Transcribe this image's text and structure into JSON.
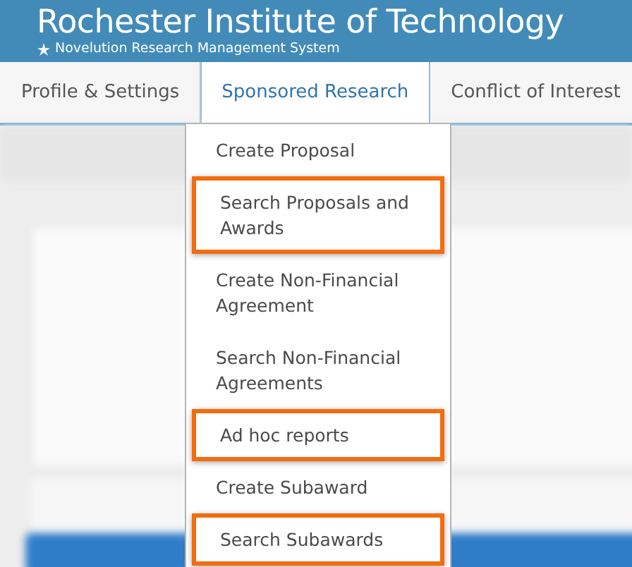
{
  "header": {
    "title": "Rochester Institute of Technology",
    "subtitle": "Novelution Research Management System"
  },
  "tabs": [
    {
      "label": "Profile & Settings",
      "selected": false
    },
    {
      "label": "Sponsored Research",
      "selected": true
    },
    {
      "label": "Conflict of Interest",
      "selected": false
    }
  ],
  "menu": {
    "items": [
      {
        "label": "Create Proposal",
        "highlighted": false
      },
      {
        "label": "Search Proposals and Awards",
        "highlighted": true
      },
      {
        "label": "Create Non-Financial Agreement",
        "highlighted": false
      },
      {
        "label": "Search Non-Financial Agreements",
        "highlighted": false
      },
      {
        "label": "Ad hoc reports",
        "highlighted": true
      },
      {
        "label": "Create Subaward",
        "highlighted": false
      },
      {
        "label": "Search Subawards",
        "highlighted": true
      }
    ]
  }
}
